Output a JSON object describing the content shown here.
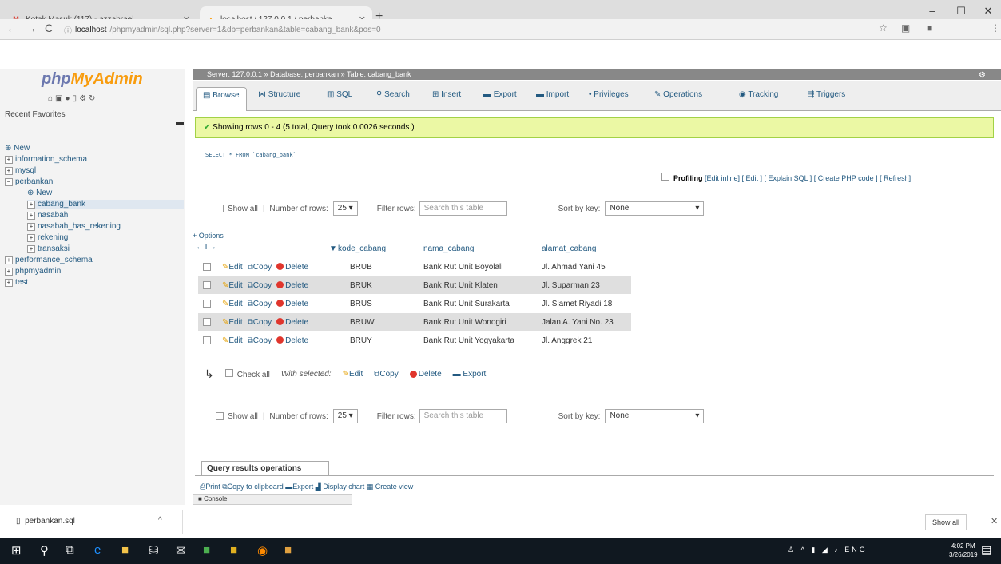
{
  "browser": {
    "tabs": [
      {
        "title": "Kotak Masuk (117) - azzahrael...",
        "favicon": "gmail-icon"
      },
      {
        "title": "localhost / 127.0.0.1 / perbanka...",
        "favicon": "pma-icon"
      }
    ],
    "new_tab": "+",
    "url_host": "localhost",
    "url_path": "/phpmyadmin/sql.php?server=1&db=perbankan&table=cabang_bank&pos=0"
  },
  "sidebar": {
    "logo_php": "php",
    "logo_my": "MyAdmin",
    "recent": "Recent",
    "favorites": "Favorites",
    "tree": [
      {
        "label": "New",
        "indent": 0
      },
      {
        "label": "information_schema",
        "indent": 0
      },
      {
        "label": "mysql",
        "indent": 0
      },
      {
        "label": "perbankan",
        "indent": 0
      },
      {
        "label": "New",
        "indent": 1
      },
      {
        "label": "cabang_bank",
        "indent": 1
      },
      {
        "label": "nasabah",
        "indent": 1
      },
      {
        "label": "nasabah_has_rekening",
        "indent": 1
      },
      {
        "label": "rekening",
        "indent": 1
      },
      {
        "label": "transaksi",
        "indent": 1
      },
      {
        "label": "performance_schema",
        "indent": 0
      },
      {
        "label": "phpmyadmin",
        "indent": 0
      },
      {
        "label": "test",
        "indent": 0
      }
    ]
  },
  "breadcrumb": {
    "server": "Server: 127.0.0.1",
    "database": "Database: perbankan",
    "table": "Table: cabang_bank"
  },
  "tabs": [
    "Browse",
    "Structure",
    "SQL",
    "Search",
    "Insert",
    "Export",
    "Import",
    "Privileges",
    "Operations",
    "Tracking",
    "Triggers"
  ],
  "success_msg": "Showing rows 0 - 4 (5 total, Query took 0.0026 seconds.)",
  "sql_query": "SELECT * FROM `cabang_bank`",
  "profiling": {
    "label": "Profiling",
    "links": "[Edit inline] [ Edit ] [ Explain SQL ] [ Create PHP code ] [ Refresh]"
  },
  "controls": {
    "show_all": "Show all",
    "number_of_rows": "Number of rows:",
    "rows_value": "25",
    "filter_rows": "Filter rows:",
    "filter_placeholder": "Search this table",
    "sort_by_key": "Sort by key:",
    "sort_value": "None"
  },
  "options": "+ Options",
  "columns": [
    "kode_cabang",
    "nama_cabang",
    "alamat_cabang"
  ],
  "actions": {
    "edit": "Edit",
    "copy": "Copy",
    "delete": "Delete"
  },
  "rows": [
    {
      "kode": "BRUB",
      "nama": "Bank Rut Unit Boyolali",
      "alamat": "Jl. Ahmad Yani 45"
    },
    {
      "kode": "BRUK",
      "nama": "Bank Rut Unit Klaten",
      "alamat": "Jl. Suparman 23"
    },
    {
      "kode": "BRUS",
      "nama": "Bank Rut Unit Surakarta",
      "alamat": "Jl. Slamet Riyadi 18"
    },
    {
      "kode": "BRUW",
      "nama": "Bank Rut Unit Wonogiri",
      "alamat": "Jalan A. Yani No. 23"
    },
    {
      "kode": "BRUY",
      "nama": "Bank Rut Unit Yogyakarta",
      "alamat": "Jl. Anggrek 21"
    }
  ],
  "bulk": {
    "check_all": "Check all",
    "with_selected": "With selected:",
    "edit": "Edit",
    "copy": "Copy",
    "delete": "Delete",
    "export": "Export"
  },
  "qro": {
    "title": "Query results operations",
    "print": "Print",
    "copy_clipboard": "Copy to clipboard",
    "export": "Export",
    "display_chart": "Display chart",
    "create_view": "Create view"
  },
  "console": "Console",
  "downloads": {
    "file": "perbankan.sql",
    "show_all": "Show all"
  },
  "taskbar": {
    "lang": "ENG",
    "time": "4:02 PM",
    "date": "3/26/2019"
  }
}
